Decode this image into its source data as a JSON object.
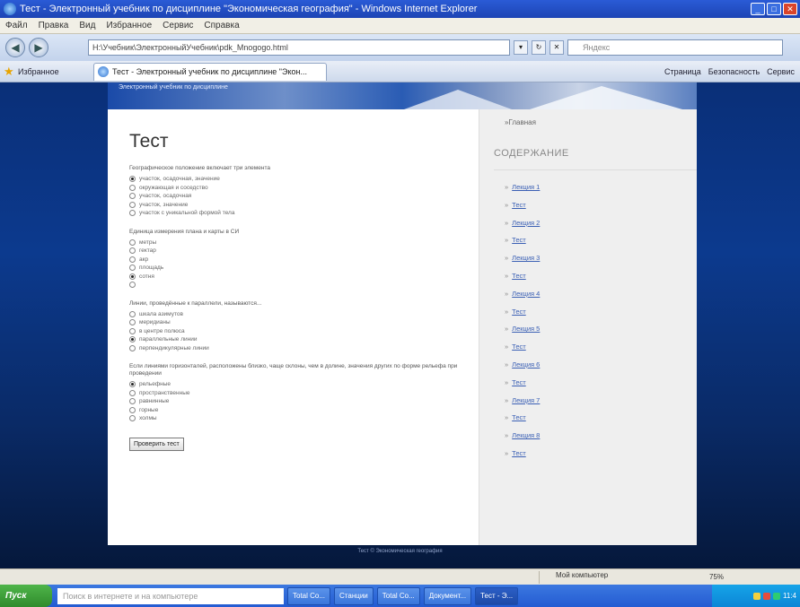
{
  "window": {
    "title": "Тест - Электронный учебник по дисциплине \"Экономическая география\" - Windows Internet Explorer"
  },
  "menu": [
    "Файл",
    "Правка",
    "Вид",
    "Избранное",
    "Сервис",
    "Справка"
  ],
  "address": {
    "url": "H:\\Учебник\\ЭлектронныйУчебник\\pdk_Mnogogo.html",
    "search_placeholder": "Яндекс"
  },
  "favorites": {
    "label": "Избранное",
    "tab_title": "Тест - Электронный учебник по дисциплине \"Экон...",
    "commands": [
      "Страница",
      "Безопасность",
      "Сервис"
    ]
  },
  "page": {
    "banner_text": "Электронный учебник по дисциплине",
    "title": "Тест",
    "questions": [
      {
        "text": "Географическое положение включает три элемента",
        "options": [
          {
            "label": "участок, осадочная, значение",
            "selected": true
          },
          {
            "label": "окружающая и соседство",
            "selected": false
          },
          {
            "label": "участок, осадочная",
            "selected": false
          },
          {
            "label": "участок, значение",
            "selected": false
          },
          {
            "label": "участок с уникальной формой тела",
            "selected": false
          }
        ]
      },
      {
        "text": "Единица измерения плана и карты в СИ",
        "options": [
          {
            "label": "метры",
            "selected": false
          },
          {
            "label": "гектар",
            "selected": false
          },
          {
            "label": "акр",
            "selected": false
          },
          {
            "label": "площадь",
            "selected": false
          },
          {
            "label": "сотня",
            "selected": true
          },
          {
            "label": "",
            "selected": false
          }
        ]
      },
      {
        "text": "Линии, проведённые к параллели, называются...",
        "options": [
          {
            "label": "шкала азимутов",
            "selected": false
          },
          {
            "label": "меридианы",
            "selected": false
          },
          {
            "label": "в центре полюса",
            "selected": false
          },
          {
            "label": "параллельные линии",
            "selected": true
          },
          {
            "label": "перпендикулярные линии",
            "selected": false
          }
        ]
      },
      {
        "text": "Если линиями горизонталей, расположены близко, чаще склоны, чем в долине, значения других по форме рельефа при проведении",
        "options": [
          {
            "label": "рельефные",
            "selected": true
          },
          {
            "label": "пространственные",
            "selected": false
          },
          {
            "label": "равнинные",
            "selected": false
          },
          {
            "label": "горные",
            "selected": false
          },
          {
            "label": "холмы",
            "selected": false
          }
        ]
      }
    ],
    "submit_label": "Проверить тест",
    "footer": "Тест © Экономическая география"
  },
  "sidebar": {
    "home": "Главная",
    "heading": "СОДЕРЖАНИЕ",
    "links": [
      "Лекция 1",
      "Тест",
      "Лекция 2",
      "Тест",
      "Лекция 3",
      "Тест",
      "Лекция 4",
      "Тест",
      "Лекция 5",
      "Тест",
      "Лекция 6",
      "Тест",
      "Лекция 7",
      "Тест",
      "Лекция 8",
      "Тест"
    ]
  },
  "statusbar": {
    "zone": "Мой компьютер",
    "zoom": "75%"
  },
  "taskbar": {
    "start": "Пуск",
    "search_placeholder": "Поиск в интернете и на компьютере",
    "tasks": [
      "Total Co...",
      "Станции",
      "Total Co...",
      "Документ...",
      "Тест - Э..."
    ],
    "clock": "11:4"
  }
}
